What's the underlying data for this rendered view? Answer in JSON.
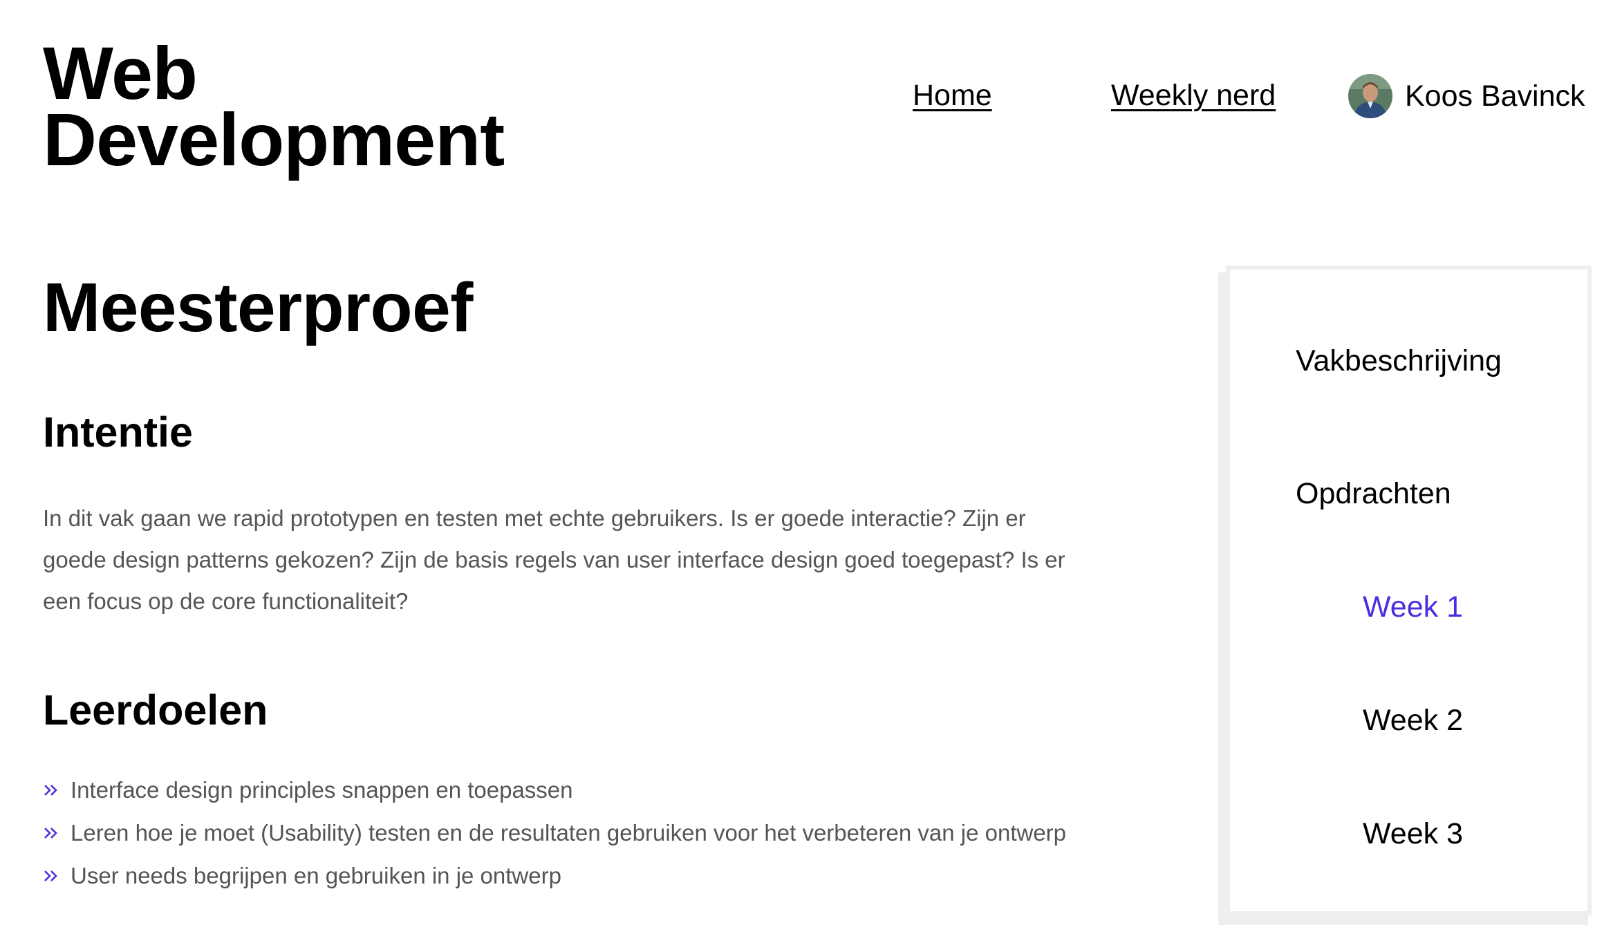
{
  "header": {
    "title_line1": "Web",
    "title_line2": "Development",
    "nav": {
      "home_label": "Home",
      "weekly_nerd_label": "Weekly nerd"
    },
    "user": {
      "name": "Koos Bavinck",
      "avatar_icon": "user-avatar"
    }
  },
  "main": {
    "page_title": "Meesterproef",
    "intentie": {
      "heading": "Intentie",
      "text": "In dit vak gaan we rapid prototypen en testen met echte gebruikers. Is er goede interactie? Zijn er goede design patterns gekozen? Zijn de basis regels van user interface design goed toegepast? Is er een focus op de core functionaliteit?"
    },
    "leerdoelen": {
      "heading": "Leerdoelen",
      "bullet_icon": "double-chevron-right-icon",
      "items": [
        "Interface design principles snappen en toepassen",
        "Leren hoe je moet (Usability) testen en de resultaten gebruiken voor het verbeteren van je ontwerp",
        "User needs begrijpen en gebruiken in je ontwerp"
      ]
    }
  },
  "sidebar": {
    "vakbeschrijving": "Vakbeschrijving",
    "opdrachten": "Opdrachten",
    "weeks": [
      {
        "label": "Week 1",
        "active": true
      },
      {
        "label": "Week 2",
        "active": false
      },
      {
        "label": "Week 3",
        "active": false
      }
    ]
  },
  "colors": {
    "accent": "#4a2ee0",
    "body_text": "#555555",
    "sidebar_border": "#eeeeee"
  }
}
